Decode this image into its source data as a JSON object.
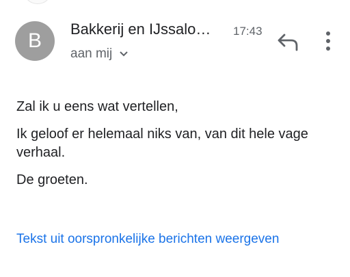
{
  "header": {
    "avatar_letter": "B",
    "sender": "Bakkerij en IJssalo…",
    "time": "17:43",
    "recipient": "aan mij",
    "icons": {
      "reply": "reply-icon",
      "more": "more-vertical-icon",
      "expand": "chevron-down-icon"
    }
  },
  "message": {
    "paragraphs": [
      "Zal ik u eens wat vertellen,",
      "Ik geloof er helemaal niks van, van dit hele vage verhaal.",
      "De groeten."
    ]
  },
  "footer": {
    "show_original_link": "Tekst uit oorspronkelijke berichten weergeven"
  },
  "colors": {
    "avatar_bg": "#9e9e9e",
    "link": "#1a73e8",
    "text": "#202124",
    "muted": "#5f6368"
  }
}
